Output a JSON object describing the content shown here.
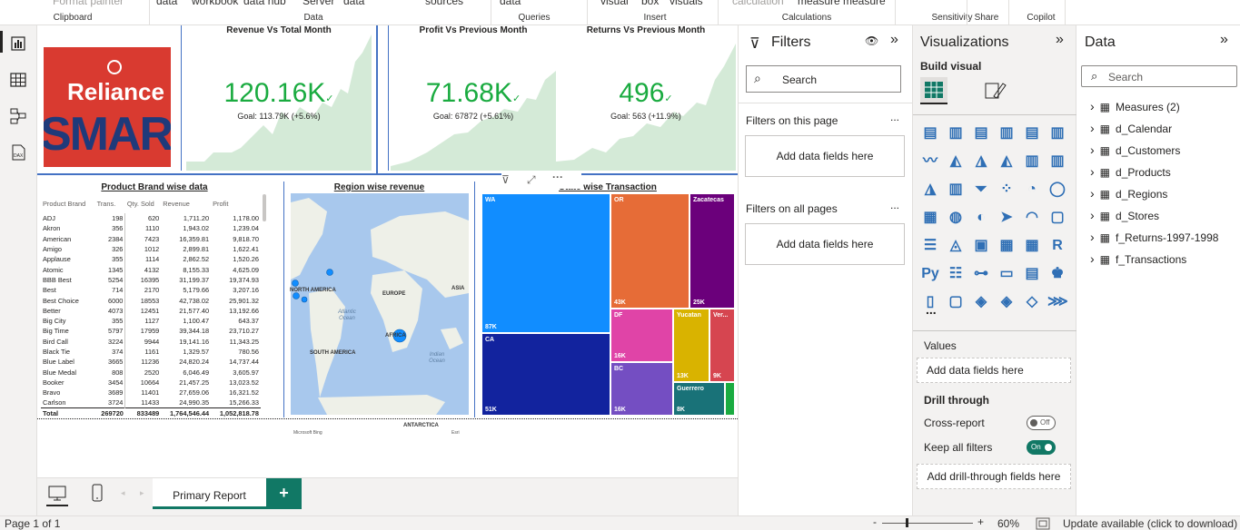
{
  "ribbon": {
    "top_items": [
      "Format painter",
      "data",
      "workbook",
      "data hub",
      "Server",
      "data",
      "sources",
      "data",
      "visual",
      "box",
      "visuals",
      "calculation",
      "measure",
      "measure"
    ],
    "groups": [
      "Clipboard",
      "Data",
      "Queries",
      "Insert",
      "Calculations",
      "Sensitivity",
      "Share",
      "Copilot"
    ]
  },
  "leftnav": {
    "icons": [
      "report-view-icon",
      "table-view-icon",
      "model-view-icon",
      "dax-query-icon"
    ]
  },
  "logo": {
    "line1": "Reliance",
    "line2": "SMAR"
  },
  "kpis": [
    {
      "title": "Revenue Vs Total Month",
      "value": "120.16K",
      "goal": "Goal: 113.79K (+5.6%)"
    },
    {
      "title": "Profit Vs Previous Month",
      "value": "71.68K",
      "goal": "Goal: 67872 (+5.61%)"
    },
    {
      "title": "Returns Vs Previous Month",
      "value": "496",
      "goal": "Goal: 563 (+11.9%)"
    }
  ],
  "brand_table": {
    "title": "Product Brand wise data",
    "columns": [
      "Product Brand",
      "Trans.",
      "Qty. Sold",
      "Revenue",
      "Profit"
    ],
    "rows": [
      [
        "ADJ",
        "198",
        "620",
        "1,711.20",
        "1,178.00"
      ],
      [
        "Akron",
        "356",
        "1110",
        "1,943.02",
        "1,239.04"
      ],
      [
        "American",
        "2384",
        "7423",
        "16,359.81",
        "9,818.70"
      ],
      [
        "Amigo",
        "326",
        "1012",
        "2,899.81",
        "1,622.41"
      ],
      [
        "Applause",
        "355",
        "1114",
        "2,862.52",
        "1,520.26"
      ],
      [
        "Atomic",
        "1345",
        "4132",
        "8,155.33",
        "4,625.09"
      ],
      [
        "BBB Best",
        "5254",
        "16395",
        "31,199.37",
        "19,374.93"
      ],
      [
        "Best",
        "714",
        "2170",
        "5,179.66",
        "3,207.16"
      ],
      [
        "Best Choice",
        "6000",
        "18553",
        "42,738.02",
        "25,901.32"
      ],
      [
        "Better",
        "4073",
        "12451",
        "21,577.40",
        "13,192.66"
      ],
      [
        "Big City",
        "355",
        "1127",
        "1,100.47",
        "643.37"
      ],
      [
        "Big Time",
        "5797",
        "17959",
        "39,344.18",
        "23,710.27"
      ],
      [
        "Bird Call",
        "3224",
        "9944",
        "19,141.16",
        "11,343.25"
      ],
      [
        "Black Tie",
        "374",
        "1161",
        "1,329.57",
        "780.56"
      ],
      [
        "Blue Label",
        "3665",
        "11236",
        "24,820.24",
        "14,737.44"
      ],
      [
        "Blue Medal",
        "808",
        "2520",
        "6,046.49",
        "3,605.97"
      ],
      [
        "Booker",
        "3454",
        "10664",
        "21,457.25",
        "13,023.52"
      ],
      [
        "Bravo",
        "3689",
        "11401",
        "27,659.06",
        "16,321.52"
      ],
      [
        "Carlson",
        "3724",
        "11433",
        "24,990.35",
        "15,266.33"
      ]
    ],
    "total": [
      "Total",
      "269720",
      "833489",
      "1,764,546.44",
      "1,052,818.78"
    ]
  },
  "map": {
    "title": "Region wise revenue",
    "labels": [
      "NORTH AMERICA",
      "EUROPE",
      "ASIA",
      "Atlantic Ocean",
      "AFRICA",
      "SOUTH AMERICA",
      "Indian Ocean",
      "ANTARCTICA"
    ],
    "attribution_left": "Microsoft Bing",
    "attribution_right": "Esri"
  },
  "treemap": {
    "title": "State wise Transaction",
    "cells": [
      {
        "label": "WA",
        "value": "87K",
        "color": "#118dff"
      },
      {
        "label": "CA",
        "value": "51K",
        "color": "#12239e"
      },
      {
        "label": "OR",
        "value": "43K",
        "color": "#e66c37"
      },
      {
        "label": "Zacatecas",
        "value": "25K",
        "color": "#6b007b"
      },
      {
        "label": "DF",
        "value": "16K",
        "color": "#e044a7"
      },
      {
        "label": "BC",
        "value": "16K",
        "color": "#744ec2"
      },
      {
        "label": "Yucatan",
        "value": "13K",
        "color": "#d9b300"
      },
      {
        "label": "Ver...",
        "value": "9K",
        "color": "#d64550"
      },
      {
        "label": "Guerrero",
        "value": "8K",
        "color": "#197278"
      },
      {
        "label": "",
        "value": "",
        "color": "#1aab40"
      }
    ]
  },
  "pages": {
    "tab": "Primary Report",
    "add_label": "+"
  },
  "filters": {
    "title": "Filters",
    "search_placeholder": "Search",
    "on_page": "Filters on this page",
    "on_all": "Filters on all pages",
    "add_fields": "Add data fields here",
    "more": "..."
  },
  "viz": {
    "title": "Visualizations",
    "build": "Build visual",
    "values_label": "Values",
    "values_drop": "Add data fields here",
    "drill_title": "Drill through",
    "cross_report": "Cross-report",
    "cross_state": "Off",
    "keep_filters": "Keep all filters",
    "keep_state": "On",
    "drill_drop": "Add drill-through fields here",
    "more": "..."
  },
  "data_pane": {
    "title": "Data",
    "search_placeholder": "Search",
    "items": [
      "Measures (2)",
      "d_Calendar",
      "d_Customers",
      "d_Products",
      "d_Regions",
      "d_Stores",
      "f_Returns-1997-1998",
      "f_Transactions"
    ]
  },
  "status": {
    "page": "Page 1 of 1",
    "zoom_minus": "-",
    "zoom_plus": "+",
    "zoom": "60%",
    "update": "Update available (click to download)"
  },
  "colors": {
    "accent": "#117865",
    "kpi_green": "#1aab40",
    "divider_blue": "#4472c4"
  }
}
